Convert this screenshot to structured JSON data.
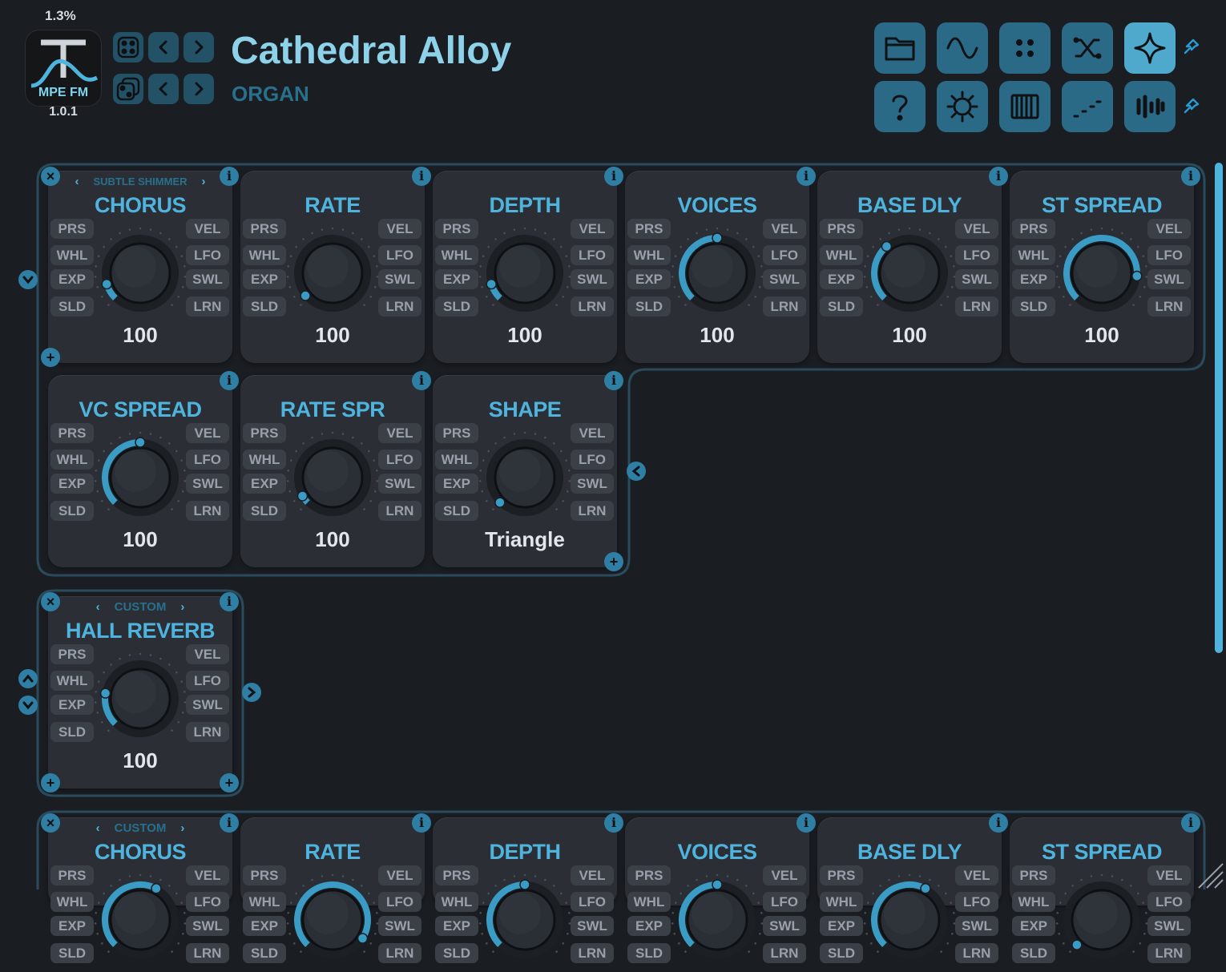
{
  "header": {
    "cpu": "1.3%",
    "logo_text": "MPE FM",
    "version": "1.0.1",
    "preset_name": "Cathedral Alloy",
    "preset_category": "ORGAN"
  },
  "toolbar": {
    "row1": [
      "folder-icon",
      "sine-wave-icon",
      "dots-grid-icon",
      "shuffle-icon",
      "sparkle-icon"
    ],
    "row2": [
      "help-icon",
      "settings-gear-icon",
      "keyboard-icon",
      "staircase-icon",
      "bars-icon"
    ]
  },
  "modifiers": {
    "left": [
      "PRS",
      "WHL",
      "EXP",
      "SLD"
    ],
    "right": [
      "VEL",
      "LFO",
      "SWL",
      "LRN"
    ]
  },
  "chorus_group": {
    "preset": "SUBTLE SHIMMER",
    "cards": [
      {
        "title": "CHORUS",
        "value": "100",
        "knob": 0.1
      },
      {
        "title": "RATE",
        "value": "100",
        "knob": 0.02
      },
      {
        "title": "DEPTH",
        "value": "100",
        "knob": 0.1
      },
      {
        "title": "VOICES",
        "value": "100",
        "knob": 0.5
      },
      {
        "title": "BASE DLY",
        "value": "100",
        "knob": 0.35
      },
      {
        "title": "ST SPREAD",
        "value": "100",
        "knob": 0.85
      }
    ],
    "row2": [
      {
        "title": "VC SPREAD",
        "value": "100",
        "knob": 0.5
      },
      {
        "title": "RATE SPR",
        "value": "100",
        "knob": 0.05
      },
      {
        "title": "SHAPE",
        "value": "Triangle",
        "knob": 0.0
      }
    ]
  },
  "reverb_group": {
    "preset": "CUSTOM",
    "card": {
      "title": "HALL REVERB",
      "value": "100",
      "knob": 0.2
    }
  },
  "chorus_group_2": {
    "preset": "CUSTOM",
    "cards": [
      {
        "title": "CHORUS",
        "knob": 0.6
      },
      {
        "title": "RATE",
        "knob": 0.95
      },
      {
        "title": "DEPTH",
        "knob": 0.5
      },
      {
        "title": "VOICES",
        "knob": 0.5
      },
      {
        "title": "BASE DLY",
        "knob": 0.6
      },
      {
        "title": "ST SPREAD",
        "knob": 0.0
      }
    ]
  },
  "colors": {
    "accent": "#4fb4dd",
    "button": "#2a6a86",
    "card": "#2b2e34",
    "background": "#1a1d22"
  }
}
